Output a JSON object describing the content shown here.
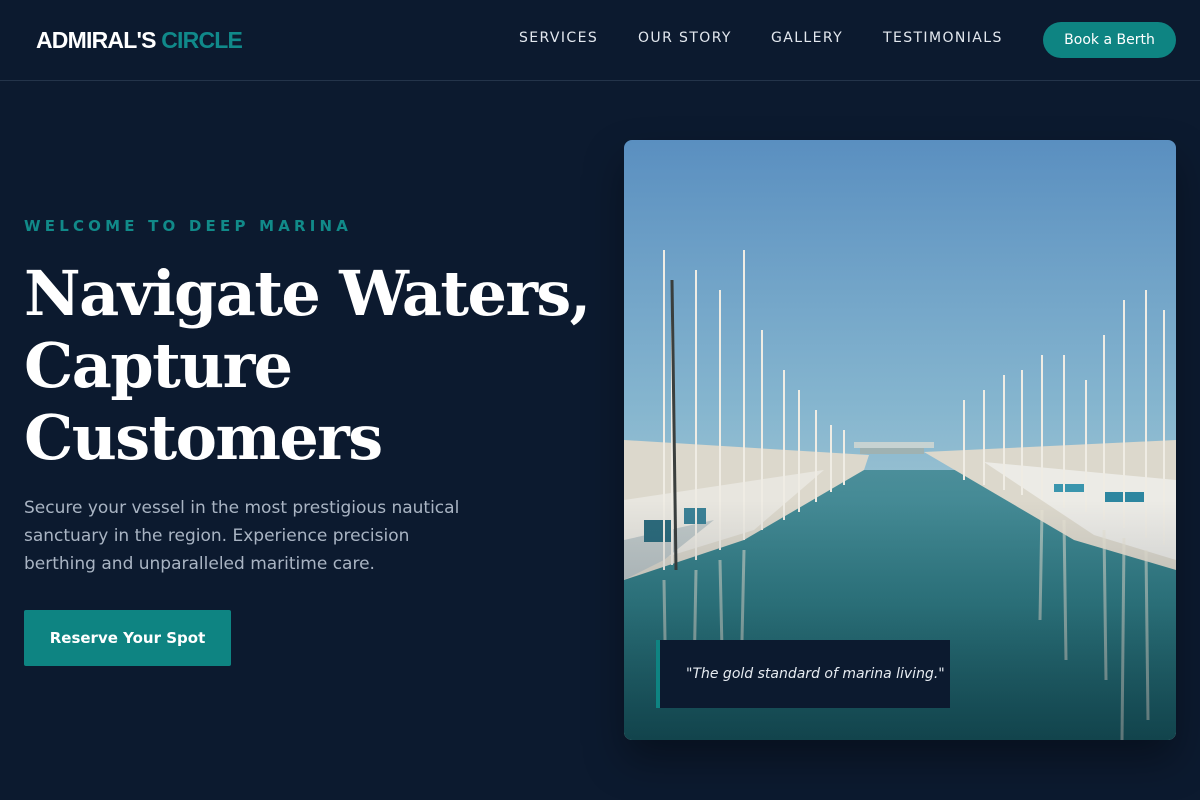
{
  "brand": {
    "name_main": "ADMIRAL'S",
    "name_accent": "CIRCLE"
  },
  "nav": {
    "items": [
      {
        "label": "SERVICES"
      },
      {
        "label": "OUR STORY"
      },
      {
        "label": "GALLERY"
      },
      {
        "label": "TESTIMONIALS"
      }
    ],
    "cta_label": "Book a Berth"
  },
  "hero": {
    "eyebrow": "WELCOME TO DEEP MARINA",
    "headline_lines": [
      "Navigate Waters,",
      "Capture",
      "Customers"
    ],
    "description": "Secure your vessel in the most prestigious nautical sanctuary in the region. Experience precision berthing and unparalleled maritime care.",
    "cta_label": "Reserve Your Spot"
  },
  "photo": {
    "quote": "\"The gold standard of marina living.\""
  },
  "colors": {
    "background": "#0c1a2f",
    "accent": "#0e8482",
    "text_muted": "#a9b4c3"
  }
}
